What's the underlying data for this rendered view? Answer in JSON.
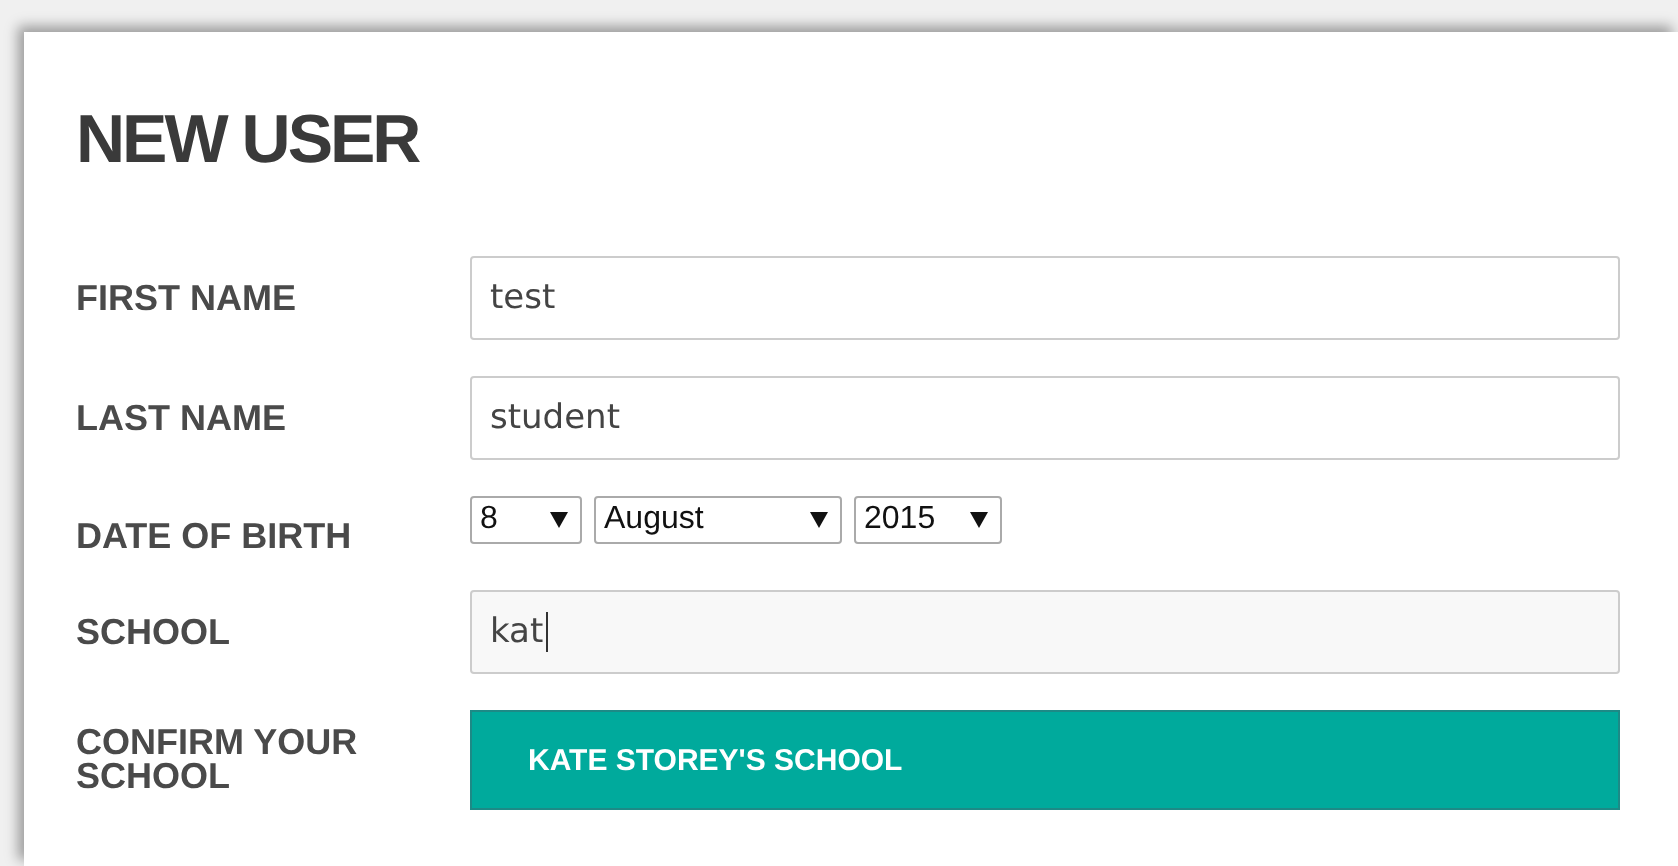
{
  "title": "NEW USER",
  "fields": [
    {
      "kind": "text",
      "label": "FIRST NAME",
      "value": "test",
      "focused": false
    },
    {
      "kind": "text",
      "label": "LAST NAME",
      "value": "student",
      "focused": false
    },
    {
      "kind": "date",
      "label": "DATE OF BIRTH",
      "selects": [
        {
          "value": "8"
        },
        {
          "value": "August"
        },
        {
          "value": "2015"
        }
      ]
    },
    {
      "kind": "text",
      "label": "SCHOOL",
      "value": "kat",
      "focused": true
    },
    {
      "kind": "choice",
      "label": "CONFIRM YOUR SCHOOL",
      "option": "KATE STOREY'S SCHOOL"
    }
  ]
}
